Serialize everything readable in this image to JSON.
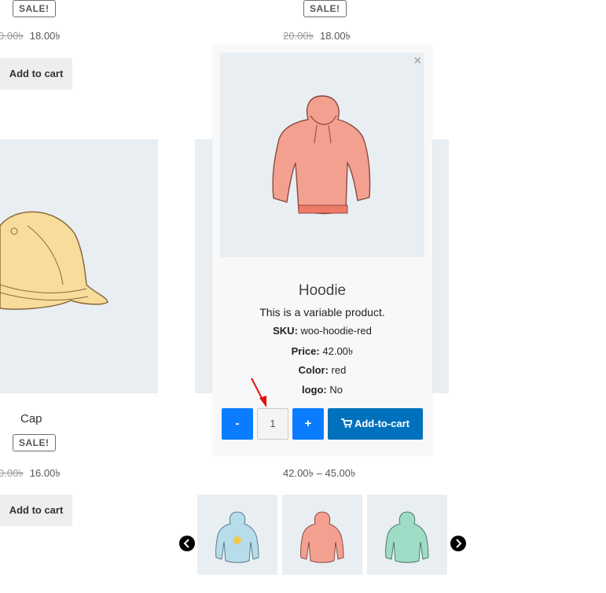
{
  "top_left": {
    "sale": "SALE!",
    "old_price": "0.00৳",
    "new_price": "18.00৳",
    "add_to_cart": "Add to cart"
  },
  "top_mid": {
    "sale": "SALE!",
    "old_price": "20.00৳",
    "new_price": "18.00৳"
  },
  "cap": {
    "title": "Cap",
    "sale": "SALE!",
    "old_price": "0.00৳",
    "new_price": "16.00৳",
    "add_to_cart": "Add to cart"
  },
  "mid_price_range": "42.00৳ – 45.00৳",
  "popup": {
    "close": "×",
    "title": "Hoodie",
    "description": "This is a variable product.",
    "sku_label": "SKU:",
    "sku_value": "woo-hoodie-red",
    "price_label": "Price:",
    "price_value": "42.00৳",
    "color_label": "Color:",
    "color_value": "red",
    "logo_label": "logo:",
    "logo_value": "No",
    "minus": "-",
    "quantity": "1",
    "plus": "+",
    "add_to_cart": "Add-to-cart"
  },
  "thumbnails": [
    "hoodie-blue-logo",
    "hoodie-red",
    "hoodie-green"
  ],
  "colors": {
    "accent_blue": "#0a7cff",
    "cart_blue": "#0071bc",
    "image_bg": "#e9eef2"
  }
}
